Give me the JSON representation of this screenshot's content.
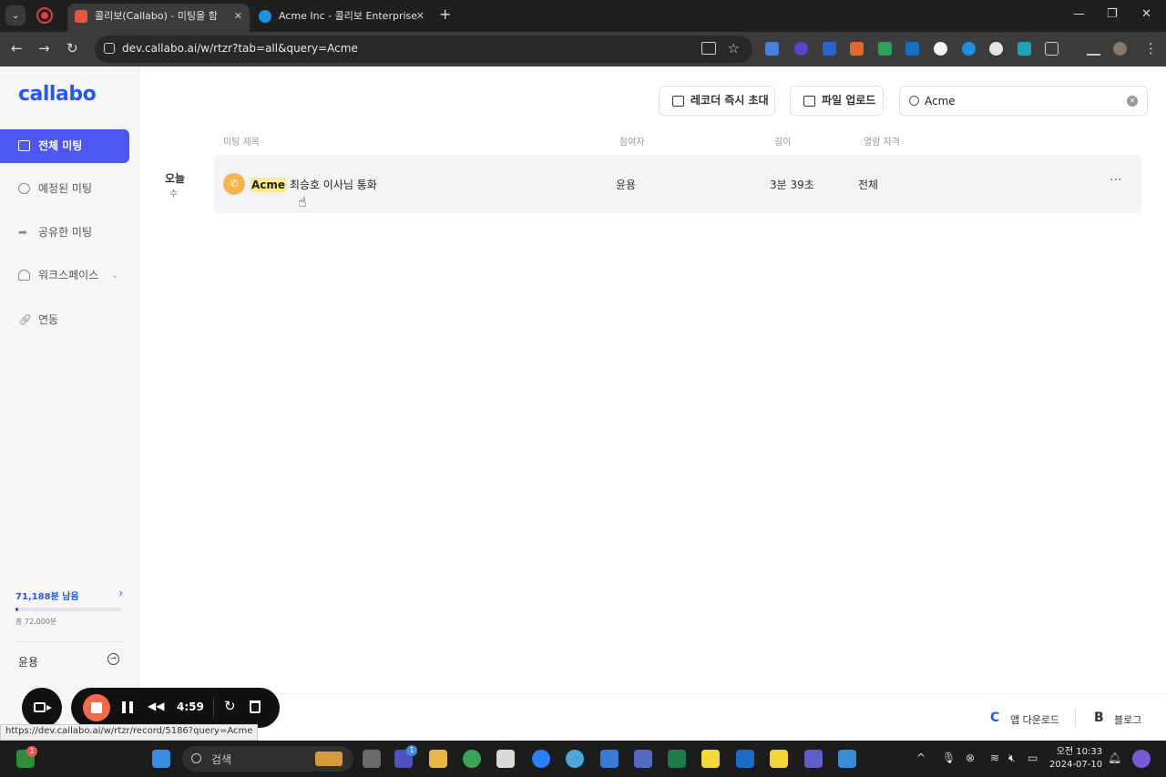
{
  "browser": {
    "tabs": [
      {
        "title": "콜리보(Callabo) - 미팅을 함",
        "active": true
      },
      {
        "title": "Acme Inc - 콜리보 Enterprise",
        "active": false
      }
    ],
    "url": "dev.callabo.ai/w/rtzr?tab=all&query=Acme",
    "status_url": "https://dev.callabo.ai/w/rtzr/record/5186?query=Acme"
  },
  "sidebar": {
    "logo": "callabo",
    "items": [
      {
        "label": "전체 미팅",
        "icon": "video-icon",
        "active": true
      },
      {
        "label": "예정된 미팅",
        "icon": "gear-icon",
        "active": false
      },
      {
        "label": "공유한 미팅",
        "icon": "share-icon",
        "active": false
      },
      {
        "label": "워크스페이스",
        "icon": "person-icon",
        "active": false
      },
      {
        "label": "연동",
        "icon": "link-icon",
        "active": false
      }
    ],
    "quota": {
      "remaining": "71,188분 남음",
      "total": "총 72,000분",
      "used_fraction": 0.011
    },
    "user": "윤용"
  },
  "header": {
    "recorder_invite": "레코더 즉시 초대",
    "file_upload": "파일 업로드",
    "search_value": "Acme"
  },
  "table": {
    "columns": {
      "title": "미팅 제목",
      "participants": "참여자",
      "length": "길이",
      "access": "열람 자격"
    },
    "date_group": {
      "day": "오늘",
      "weekday": "수"
    },
    "rows": [
      {
        "highlight": "Acme",
        "title_rest": " 최승호 이사님 통화",
        "participants": "윤용",
        "length": "3분 39초",
        "access": "전체"
      }
    ]
  },
  "footer": {
    "app_download": "앱 다운로드",
    "blog": "블로그"
  },
  "recorder": {
    "time": "4:59"
  },
  "taskbar": {
    "search": "검색",
    "clock_time": "오전 10:33",
    "clock_date": "2024-07-10"
  },
  "colors": {
    "accent": "#4b57f0",
    "brand": "#2957e6",
    "highlight": "#fbe98a",
    "call_icon": "#f4b54b",
    "record_stop": "#f06a4e"
  }
}
